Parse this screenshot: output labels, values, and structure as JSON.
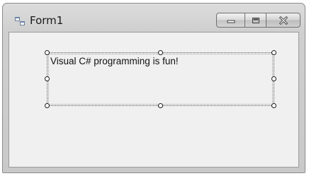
{
  "window": {
    "title": "Form1",
    "icon": "form-icon",
    "buttons": {
      "minimize": "minimize-icon",
      "maximize": "maximize-icon",
      "close": "close-icon"
    }
  },
  "designer": {
    "label_text": "Visual C# programming is fun!",
    "selected": true
  }
}
